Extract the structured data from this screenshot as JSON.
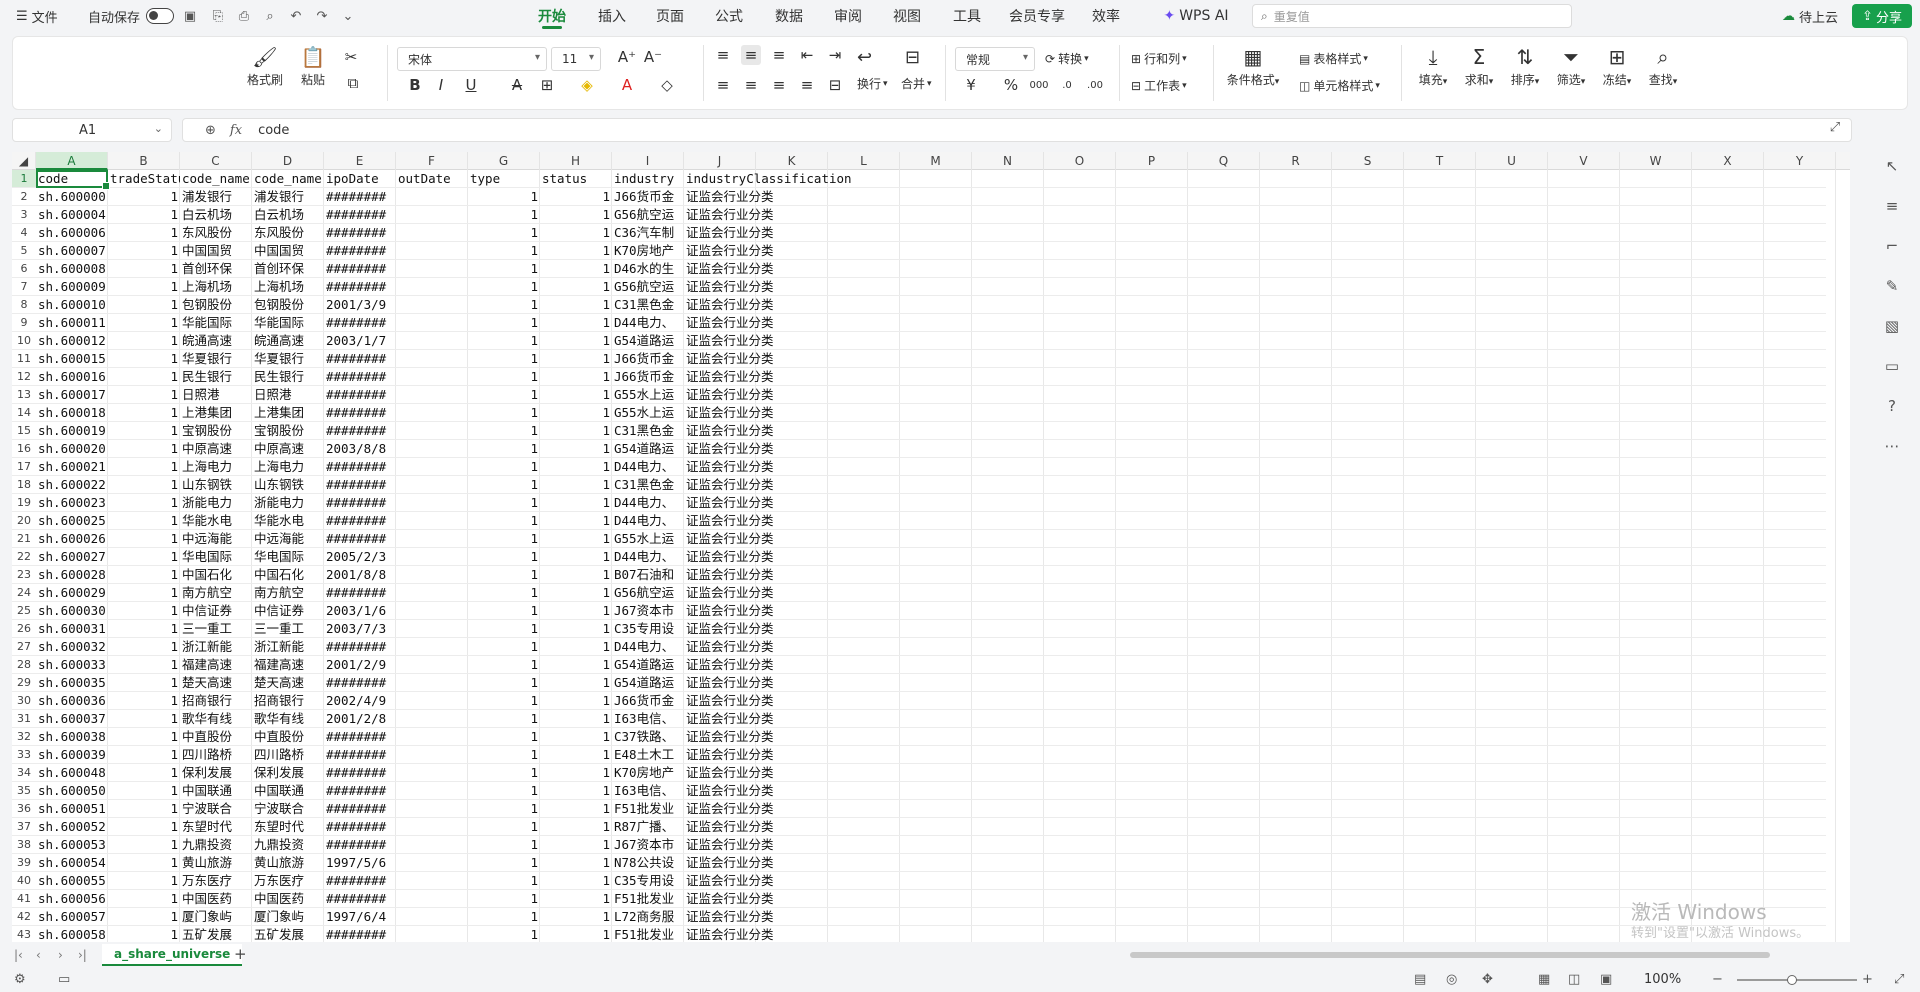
{
  "titlebar": {
    "file_menu": "文件",
    "autosave": "自动保存",
    "tabs": [
      "开始",
      "插入",
      "页面",
      "公式",
      "数据",
      "审阅",
      "视图",
      "工具",
      "会员专享",
      "效率"
    ],
    "active_tab": "开始",
    "wps_ai": "WPS AI",
    "search_placeholder": "重复值",
    "cloud": "待上云",
    "share": "分享"
  },
  "ribbon": {
    "format_painter": "格式刷",
    "paste": "粘贴",
    "font_name": "宋体",
    "font_size": "11",
    "wrap": "换行",
    "merge": "合并",
    "number_format": "常规",
    "convert": "转换",
    "rows_cols": "行和列",
    "worksheet": "工作表",
    "cond_format": "条件格式",
    "table_style": "表格样式",
    "cell_style": "单元格样式",
    "fill": "填充",
    "sum": "求和",
    "sort": "排序",
    "filter": "筛选",
    "freeze": "冻结",
    "find": "查找"
  },
  "formula_bar": {
    "cell_ref": "A1",
    "fx": "fx",
    "content": "code"
  },
  "columns": [
    "A",
    "B",
    "C",
    "D",
    "E",
    "F",
    "G",
    "H",
    "I",
    "J",
    "K",
    "L",
    "M",
    "N",
    "O",
    "P",
    "Q",
    "R",
    "S",
    "T",
    "U",
    "V",
    "W",
    "X",
    "Y"
  ],
  "header_row": [
    "code",
    "tradeStatus",
    "code_name",
    "code_name",
    "ipoDate",
    "outDate",
    "type",
    "status",
    "industry",
    "industryClassification"
  ],
  "rows": [
    [
      "sh.600000",
      "1",
      "浦发银行",
      "浦发银行",
      "########",
      "",
      "1",
      "1",
      "J66货币金",
      "证监会行业分类"
    ],
    [
      "sh.600004",
      "1",
      "白云机场",
      "白云机场",
      "########",
      "",
      "1",
      "1",
      "G56航空运",
      "证监会行业分类"
    ],
    [
      "sh.600006",
      "1",
      "东风股份",
      "东风股份",
      "########",
      "",
      "1",
      "1",
      "C36汽车制",
      "证监会行业分类"
    ],
    [
      "sh.600007",
      "1",
      "中国国贸",
      "中国国贸",
      "########",
      "",
      "1",
      "1",
      "K70房地产",
      "证监会行业分类"
    ],
    [
      "sh.600008",
      "1",
      "首创环保",
      "首创环保",
      "########",
      "",
      "1",
      "1",
      "D46水的生",
      "证监会行业分类"
    ],
    [
      "sh.600009",
      "1",
      "上海机场",
      "上海机场",
      "########",
      "",
      "1",
      "1",
      "G56航空运",
      "证监会行业分类"
    ],
    [
      "sh.600010",
      "1",
      "包钢股份",
      "包钢股份",
      "2001/3/9",
      "",
      "1",
      "1",
      "C31黑色金",
      "证监会行业分类"
    ],
    [
      "sh.600011",
      "1",
      "华能国际",
      "华能国际",
      "########",
      "",
      "1",
      "1",
      "D44电力、",
      "证监会行业分类"
    ],
    [
      "sh.600012",
      "1",
      "皖通高速",
      "皖通高速",
      "2003/1/7",
      "",
      "1",
      "1",
      "G54道路运",
      "证监会行业分类"
    ],
    [
      "sh.600015",
      "1",
      "华夏银行",
      "华夏银行",
      "########",
      "",
      "1",
      "1",
      "J66货币金",
      "证监会行业分类"
    ],
    [
      "sh.600016",
      "1",
      "民生银行",
      "民生银行",
      "########",
      "",
      "1",
      "1",
      "J66货币金",
      "证监会行业分类"
    ],
    [
      "sh.600017",
      "1",
      "日照港",
      "日照港",
      "########",
      "",
      "1",
      "1",
      "G55水上运",
      "证监会行业分类"
    ],
    [
      "sh.600018",
      "1",
      "上港集团",
      "上港集团",
      "########",
      "",
      "1",
      "1",
      "G55水上运",
      "证监会行业分类"
    ],
    [
      "sh.600019",
      "1",
      "宝钢股份",
      "宝钢股份",
      "########",
      "",
      "1",
      "1",
      "C31黑色金",
      "证监会行业分类"
    ],
    [
      "sh.600020",
      "1",
      "中原高速",
      "中原高速",
      "2003/8/8",
      "",
      "1",
      "1",
      "G54道路运",
      "证监会行业分类"
    ],
    [
      "sh.600021",
      "1",
      "上海电力",
      "上海电力",
      "########",
      "",
      "1",
      "1",
      "D44电力、",
      "证监会行业分类"
    ],
    [
      "sh.600022",
      "1",
      "山东钢铁",
      "山东钢铁",
      "########",
      "",
      "1",
      "1",
      "C31黑色金",
      "证监会行业分类"
    ],
    [
      "sh.600023",
      "1",
      "浙能电力",
      "浙能电力",
      "########",
      "",
      "1",
      "1",
      "D44电力、",
      "证监会行业分类"
    ],
    [
      "sh.600025",
      "1",
      "华能水电",
      "华能水电",
      "########",
      "",
      "1",
      "1",
      "D44电力、",
      "证监会行业分类"
    ],
    [
      "sh.600026",
      "1",
      "中远海能",
      "中远海能",
      "########",
      "",
      "1",
      "1",
      "G55水上运",
      "证监会行业分类"
    ],
    [
      "sh.600027",
      "1",
      "华电国际",
      "华电国际",
      "2005/2/3",
      "",
      "1",
      "1",
      "D44电力、",
      "证监会行业分类"
    ],
    [
      "sh.600028",
      "1",
      "中国石化",
      "中国石化",
      "2001/8/8",
      "",
      "1",
      "1",
      "B07石油和",
      "证监会行业分类"
    ],
    [
      "sh.600029",
      "1",
      "南方航空",
      "南方航空",
      "########",
      "",
      "1",
      "1",
      "G56航空运",
      "证监会行业分类"
    ],
    [
      "sh.600030",
      "1",
      "中信证券",
      "中信证券",
      "2003/1/6",
      "",
      "1",
      "1",
      "J67资本市",
      "证监会行业分类"
    ],
    [
      "sh.600031",
      "1",
      "三一重工",
      "三一重工",
      "2003/7/3",
      "",
      "1",
      "1",
      "C35专用设",
      "证监会行业分类"
    ],
    [
      "sh.600032",
      "1",
      "浙江新能",
      "浙江新能",
      "########",
      "",
      "1",
      "1",
      "D44电力、",
      "证监会行业分类"
    ],
    [
      "sh.600033",
      "1",
      "福建高速",
      "福建高速",
      "2001/2/9",
      "",
      "1",
      "1",
      "G54道路运",
      "证监会行业分类"
    ],
    [
      "sh.600035",
      "1",
      "楚天高速",
      "楚天高速",
      "########",
      "",
      "1",
      "1",
      "G54道路运",
      "证监会行业分类"
    ],
    [
      "sh.600036",
      "1",
      "招商银行",
      "招商银行",
      "2002/4/9",
      "",
      "1",
      "1",
      "J66货币金",
      "证监会行业分类"
    ],
    [
      "sh.600037",
      "1",
      "歌华有线",
      "歌华有线",
      "2001/2/8",
      "",
      "1",
      "1",
      "I63电信、",
      "证监会行业分类"
    ],
    [
      "sh.600038",
      "1",
      "中直股份",
      "中直股份",
      "########",
      "",
      "1",
      "1",
      "C37铁路、",
      "证监会行业分类"
    ],
    [
      "sh.600039",
      "1",
      "四川路桥",
      "四川路桥",
      "########",
      "",
      "1",
      "1",
      "E48土木工",
      "证监会行业分类"
    ],
    [
      "sh.600048",
      "1",
      "保利发展",
      "保利发展",
      "########",
      "",
      "1",
      "1",
      "K70房地产",
      "证监会行业分类"
    ],
    [
      "sh.600050",
      "1",
      "中国联通",
      "中国联通",
      "########",
      "",
      "1",
      "1",
      "I63电信、",
      "证监会行业分类"
    ],
    [
      "sh.600051",
      "1",
      "宁波联合",
      "宁波联合",
      "########",
      "",
      "1",
      "1",
      "F51批发业",
      "证监会行业分类"
    ],
    [
      "sh.600052",
      "1",
      "东望时代",
      "东望时代",
      "########",
      "",
      "1",
      "1",
      "R87广播、",
      "证监会行业分类"
    ],
    [
      "sh.600053",
      "1",
      "九鼎投资",
      "九鼎投资",
      "########",
      "",
      "1",
      "1",
      "J67资本市",
      "证监会行业分类"
    ],
    [
      "sh.600054",
      "1",
      "黄山旅游",
      "黄山旅游",
      "1997/5/6",
      "",
      "1",
      "1",
      "N78公共设",
      "证监会行业分类"
    ],
    [
      "sh.600055",
      "1",
      "万东医疗",
      "万东医疗",
      "########",
      "",
      "1",
      "1",
      "C35专用设",
      "证监会行业分类"
    ],
    [
      "sh.600056",
      "1",
      "中国医药",
      "中国医药",
      "########",
      "",
      "1",
      "1",
      "F51批发业",
      "证监会行业分类"
    ],
    [
      "sh.600057",
      "1",
      "厦门象屿",
      "厦门象屿",
      "1997/6/4",
      "",
      "1",
      "1",
      "L72商务服",
      "证监会行业分类"
    ],
    [
      "sh.600058",
      "1",
      "五矿发展",
      "五矿发展",
      "########",
      "",
      "1",
      "1",
      "F51批发业",
      "证监会行业分类"
    ]
  ],
  "sheet_tab": "a_share_universe",
  "status": {
    "zoom": "100%"
  },
  "watermark": {
    "line1": "激活 Windows",
    "line2": "转到\"设置\"以激活 Windows。"
  },
  "colors": {
    "accent": "#1a8a3c",
    "share_bg": "#17a04c"
  }
}
